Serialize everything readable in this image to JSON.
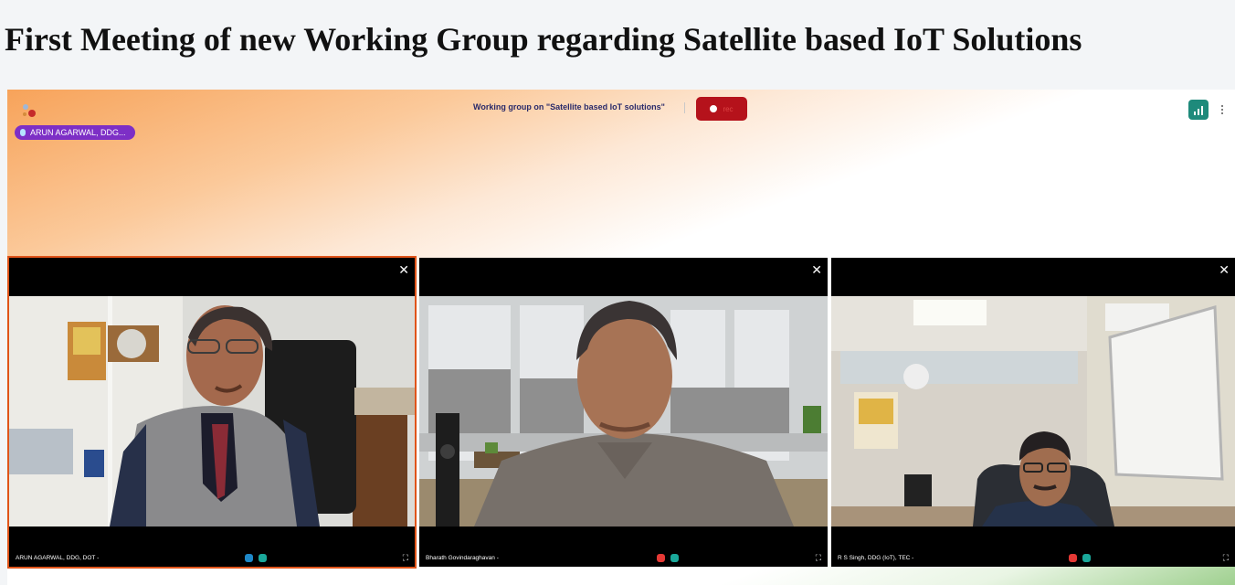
{
  "page_title": "First Meeting of new Working Group regarding Satellite based IoT Solutions",
  "meeting": {
    "name": "Working group on \"Satellite based IoT solutions\"",
    "active_speaker": "ARUN AGARWAL, DDG...",
    "recording_indicator": "rec"
  },
  "tiles": [
    {
      "name": "ARUN AGARWAL, DDG, DOT -",
      "mic": "unmuted",
      "camera": "on",
      "active": true
    },
    {
      "name": "Bharath Govindaraghavan -",
      "mic": "muted",
      "camera": "on",
      "active": false
    },
    {
      "name": "R S Singh, DDG (IoT), TEC -",
      "mic": "muted",
      "camera": "on",
      "active": false
    }
  ],
  "colors": {
    "accent_orange": "#e0541a",
    "record_red": "#b5121b",
    "speaker_purple": "#7d2fc6",
    "network_teal": "#1e8a7b",
    "mic_unmuted": "#1e88c8",
    "mic_muted": "#e53935",
    "camera_on": "#1aa89a"
  },
  "icons": {
    "close": "close-icon",
    "expand": "expand-icon",
    "mic": "mic-icon",
    "camera": "camera-icon",
    "network": "signal-icon",
    "more": "more-icon",
    "app": "app-logo"
  }
}
